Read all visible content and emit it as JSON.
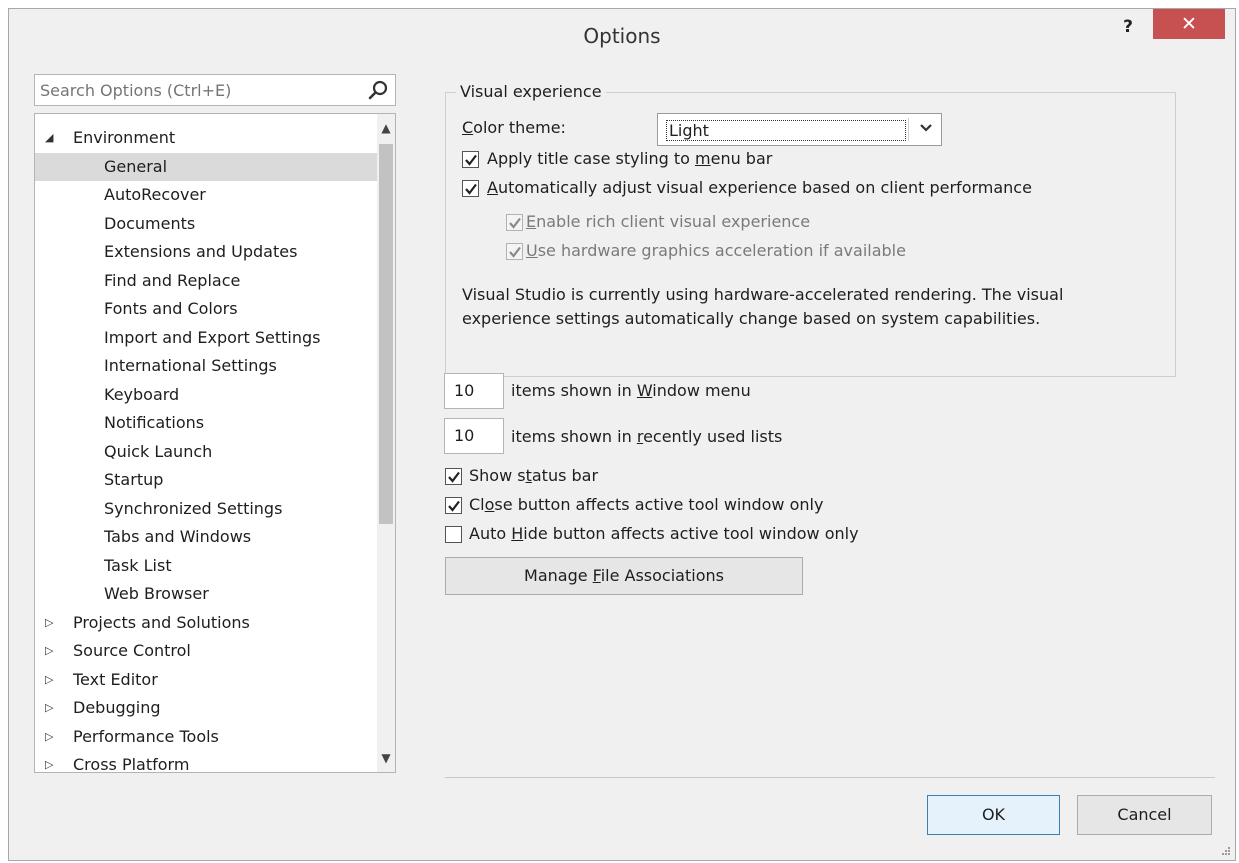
{
  "window": {
    "title": "Options",
    "help_label": "?",
    "close_label": "✕"
  },
  "search": {
    "placeholder": "Search Options (Ctrl+E)"
  },
  "tree": {
    "items": [
      {
        "label": "Environment",
        "level": 0,
        "expander": "expanded"
      },
      {
        "label": "General",
        "level": 1,
        "selected": true
      },
      {
        "label": "AutoRecover",
        "level": 1
      },
      {
        "label": "Documents",
        "level": 1
      },
      {
        "label": "Extensions and Updates",
        "level": 1
      },
      {
        "label": "Find and Replace",
        "level": 1
      },
      {
        "label": "Fonts and Colors",
        "level": 1
      },
      {
        "label": "Import and Export Settings",
        "level": 1
      },
      {
        "label": "International Settings",
        "level": 1
      },
      {
        "label": "Keyboard",
        "level": 1
      },
      {
        "label": "Notifications",
        "level": 1
      },
      {
        "label": "Quick Launch",
        "level": 1
      },
      {
        "label": "Startup",
        "level": 1
      },
      {
        "label": "Synchronized Settings",
        "level": 1
      },
      {
        "label": "Tabs and Windows",
        "level": 1
      },
      {
        "label": "Task List",
        "level": 1
      },
      {
        "label": "Web Browser",
        "level": 1
      },
      {
        "label": "Projects and Solutions",
        "level": 0,
        "expander": "collapsed"
      },
      {
        "label": "Source Control",
        "level": 0,
        "expander": "collapsed"
      },
      {
        "label": "Text Editor",
        "level": 0,
        "expander": "collapsed"
      },
      {
        "label": "Debugging",
        "level": 0,
        "expander": "collapsed"
      },
      {
        "label": "Performance Tools",
        "level": 0,
        "expander": "collapsed"
      },
      {
        "label": "Cross Platform",
        "level": 0,
        "expander": "collapsed"
      }
    ]
  },
  "visual_experience": {
    "legend": "Visual experience",
    "color_theme": {
      "label_pre": "",
      "label_u": "C",
      "label_post": "olor theme:",
      "value": "Light"
    },
    "apply_title_case": {
      "pre": "Apply title case styling to ",
      "u": "m",
      "post": "enu bar",
      "checked": true
    },
    "auto_adjust": {
      "pre": "",
      "u": "A",
      "post": "utomatically adjust visual experience based on client performance",
      "checked": true
    },
    "rich_client": {
      "pre": "",
      "u": "E",
      "post": "nable rich client visual experience",
      "checked": true,
      "disabled": true
    },
    "hw_accel": {
      "pre": "",
      "u": "U",
      "post": "se hardware graphics acceleration if available",
      "checked": true,
      "disabled": true
    },
    "info_line1": "Visual Studio is currently using hardware-accelerated rendering. The visual",
    "info_line2": "experience settings automatically change based on system capabilities."
  },
  "window_menu": {
    "value": "10",
    "pre": "items shown in ",
    "u": "W",
    "post": "indow menu"
  },
  "recent_lists": {
    "value": "10",
    "pre": "items shown in ",
    "u": "r",
    "post": "ecently used lists"
  },
  "show_status_bar": {
    "pre": "Show s",
    "u": "t",
    "post": "atus bar",
    "checked": true
  },
  "close_button": {
    "pre": "Cl",
    "u": "o",
    "post": "se button affects active tool window only",
    "checked": true
  },
  "auto_hide": {
    "pre": "Auto ",
    "u": "H",
    "post": "ide button affects active tool window only",
    "checked": false
  },
  "manage_file_assoc": {
    "pre": "Manage ",
    "u": "F",
    "post": "ile Associations"
  },
  "footer": {
    "ok_label": "OK",
    "cancel_label": "Cancel"
  },
  "colors": {
    "close_button": "#c75050",
    "selected_row": "#dadada",
    "default_button_border": "#3c7fb1"
  }
}
